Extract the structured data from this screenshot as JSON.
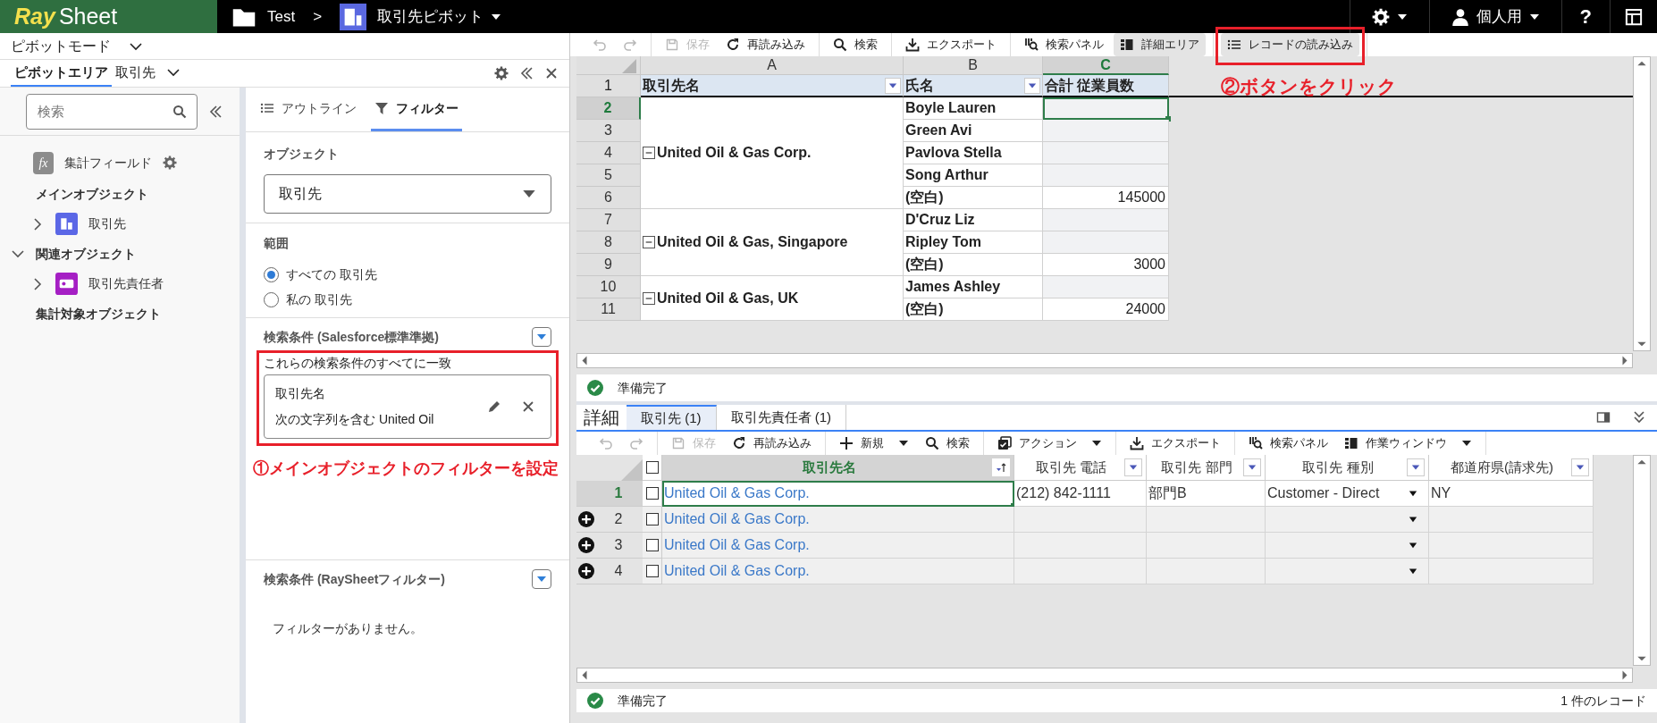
{
  "header": {
    "logo": {
      "mark": "Ray",
      "word": "Sheet"
    },
    "folder": "Test",
    "separator": ">",
    "title": "取引先ピボット",
    "user": "個人用",
    "help": "?"
  },
  "left_panel": {
    "mode": "ピボットモード",
    "tabs": [
      {
        "label": "ピボットエリア",
        "selected": true
      },
      {
        "label": "取引先",
        "selected": false
      }
    ],
    "search": {
      "placeholder": "検索"
    },
    "tree": [
      {
        "kind": "field",
        "label": "集計フィールド",
        "icon_text": "fx"
      },
      {
        "kind": "heading",
        "label": "メインオブジェクト",
        "children": [
          {
            "kind": "object",
            "label": "取引先",
            "expanded": false,
            "color": "#5b67e6"
          }
        ]
      },
      {
        "kind": "collapsible",
        "label": "関連オブジェクト",
        "expanded": true,
        "children": [
          {
            "kind": "object",
            "label": "取引先責任者",
            "expanded": false,
            "color": "#a51fc4"
          }
        ]
      },
      {
        "kind": "heading",
        "label": "集計対象オブジェクト"
      }
    ]
  },
  "filter_panel": {
    "tabs": [
      {
        "label": "アウトライン",
        "selected": false
      },
      {
        "label": "フィルター",
        "selected": true
      }
    ],
    "object_label": "オブジェクト",
    "object_value": "取引先",
    "scope_label": "範囲",
    "scope_options": [
      {
        "label": "すべての 取引先",
        "selected": true
      },
      {
        "label": "私の 取引先",
        "selected": false
      }
    ],
    "sf_conditions": {
      "title": "検索条件 (Salesforce標準準拠)",
      "match_label": "これらの検索条件のすべてに一致",
      "filters": [
        {
          "field": "取引先名",
          "condition": "次の文字列を含む United Oil"
        }
      ]
    },
    "rs_conditions": {
      "title": "検索条件 (RaySheetフィルター)",
      "empty": "フィルターがありません。"
    }
  },
  "annotations": [
    {
      "text": "①メインオブジェクトのフィルターを設定"
    },
    {
      "text": "②ボタンをクリック"
    }
  ],
  "pivot_toolbar": {
    "groups": [
      {
        "buttons": [
          {
            "kind": "undo",
            "disabled": true,
            "active": false
          },
          {
            "kind": "redo",
            "disabled": true,
            "active": false
          }
        ]
      },
      {
        "buttons": [
          {
            "kind": "save",
            "label": "保存",
            "disabled": true,
            "active": false
          },
          {
            "kind": "reload",
            "label": "再読み込み",
            "disabled": false,
            "active": false
          }
        ]
      },
      {
        "buttons": [
          {
            "kind": "search",
            "label": "検索",
            "disabled": false,
            "active": false
          }
        ]
      },
      {
        "buttons": [
          {
            "kind": "export",
            "label": "エクスポート",
            "disabled": false,
            "active": false
          }
        ]
      },
      {
        "buttons": [
          {
            "kind": "panel",
            "label": "検索パネル",
            "disabled": false,
            "active": false
          },
          {
            "kind": "columns",
            "label": "詳細エリア",
            "disabled": false,
            "active": true
          }
        ]
      },
      {
        "buttons": [
          {
            "kind": "list",
            "label": "レコードの読み込み",
            "disabled": false,
            "active": true
          }
        ]
      }
    ]
  },
  "pivot_sheet": {
    "columns": [
      {
        "letter": "A",
        "selected": false,
        "header": "取引先名",
        "filter": true
      },
      {
        "letter": "B",
        "selected": false,
        "header": "氏名",
        "filter": true
      },
      {
        "letter": "C",
        "selected": true,
        "header": "合計 従業員数",
        "filter": false
      }
    ],
    "header_row_number": "1",
    "groups": [
      {
        "name": "United Oil & Gas Corp.",
        "expanded": true,
        "rows": [
          {
            "row_number": "2",
            "name": "Boyle Lauren",
            "selected": true
          },
          {
            "row_number": "3",
            "name": "Green Avi",
            "selected": false
          },
          {
            "row_number": "4",
            "name": "Pavlova Stella",
            "selected": false
          },
          {
            "row_number": "5",
            "name": "Song Arthur",
            "selected": false
          },
          {
            "row_number": "6",
            "name": "(空白)",
            "value": "145000",
            "selected": false
          }
        ]
      },
      {
        "name": "United Oil & Gas, Singapore",
        "expanded": true,
        "rows": [
          {
            "row_number": "7",
            "name": "D'Cruz Liz",
            "selected": false
          },
          {
            "row_number": "8",
            "name": "Ripley Tom",
            "selected": false
          },
          {
            "row_number": "9",
            "name": "(空白)",
            "value": "3000",
            "selected": false
          }
        ]
      },
      {
        "name": "United Oil & Gas, UK",
        "expanded": true,
        "rows": [
          {
            "row_number": "10",
            "name": "James Ashley",
            "selected": false
          },
          {
            "row_number": "11",
            "name": "(空白)",
            "value": "24000",
            "selected": false
          }
        ]
      }
    ]
  },
  "pivot_status": "準備完了",
  "detail": {
    "title": "詳細",
    "tabs": [
      {
        "label": "取引先 (1)",
        "selected": true
      },
      {
        "label": "取引先責任者 (1)",
        "selected": false
      }
    ],
    "toolbar": {
      "groups": [
        {
          "buttons": [
            {
              "kind": "undo",
              "disabled": true,
              "dropdown": false
            },
            {
              "kind": "redo",
              "disabled": true,
              "dropdown": false
            }
          ]
        },
        {
          "buttons": [
            {
              "kind": "save",
              "label": "保存",
              "disabled": true,
              "dropdown": false
            },
            {
              "kind": "reload",
              "label": "再読み込み",
              "disabled": false,
              "dropdown": false
            }
          ]
        },
        {
          "buttons": [
            {
              "kind": "plus",
              "label": "新規",
              "disabled": false,
              "dropdown": true
            },
            {
              "kind": "search",
              "label": "検索",
              "disabled": false,
              "dropdown": false
            }
          ]
        },
        {
          "buttons": [
            {
              "kind": "action",
              "label": "アクション",
              "disabled": false,
              "dropdown": true
            }
          ]
        },
        {
          "buttons": [
            {
              "kind": "export",
              "label": "エクスポート",
              "disabled": false,
              "dropdown": false
            }
          ]
        },
        {
          "buttons": [
            {
              "kind": "panel",
              "label": "検索パネル",
              "disabled": false,
              "dropdown": false
            },
            {
              "kind": "columns",
              "label": "作業ウィンドウ",
              "disabled": false,
              "dropdown": true
            }
          ]
        }
      ]
    },
    "all_checked": false,
    "columns": [
      {
        "label": "取引先名",
        "kind": "link",
        "selected": true,
        "sorted": true
      },
      {
        "label": "取引先 電話",
        "kind": "text",
        "selected": false,
        "sorted": false
      },
      {
        "label": "取引先 部門",
        "kind": "text",
        "selected": false,
        "sorted": false
      },
      {
        "label": "取引先 種別",
        "kind": "picklist",
        "selected": false,
        "sorted": false
      },
      {
        "label": "都道府県(請求先)",
        "kind": "text",
        "selected": false,
        "sorted": false
      }
    ],
    "rows": [
      {
        "number": "1",
        "selected": true,
        "add_marker": false,
        "checked": false,
        "cells": [
          "United Oil & Gas Corp.",
          "(212) 842-1111",
          "部門B",
          "Customer - Direct",
          "NY"
        ]
      },
      {
        "number": "2",
        "selected": false,
        "add_marker": true,
        "checked": false,
        "cells": [
          "United Oil & Gas Corp."
        ]
      },
      {
        "number": "3",
        "selected": false,
        "add_marker": true,
        "checked": false,
        "cells": [
          "United Oil & Gas Corp."
        ]
      },
      {
        "number": "4",
        "selected": false,
        "add_marker": true,
        "checked": false,
        "cells": [
          "United Oil & Gas Corp."
        ]
      }
    ],
    "status": "準備完了",
    "record_count": "1 件のレコード"
  }
}
